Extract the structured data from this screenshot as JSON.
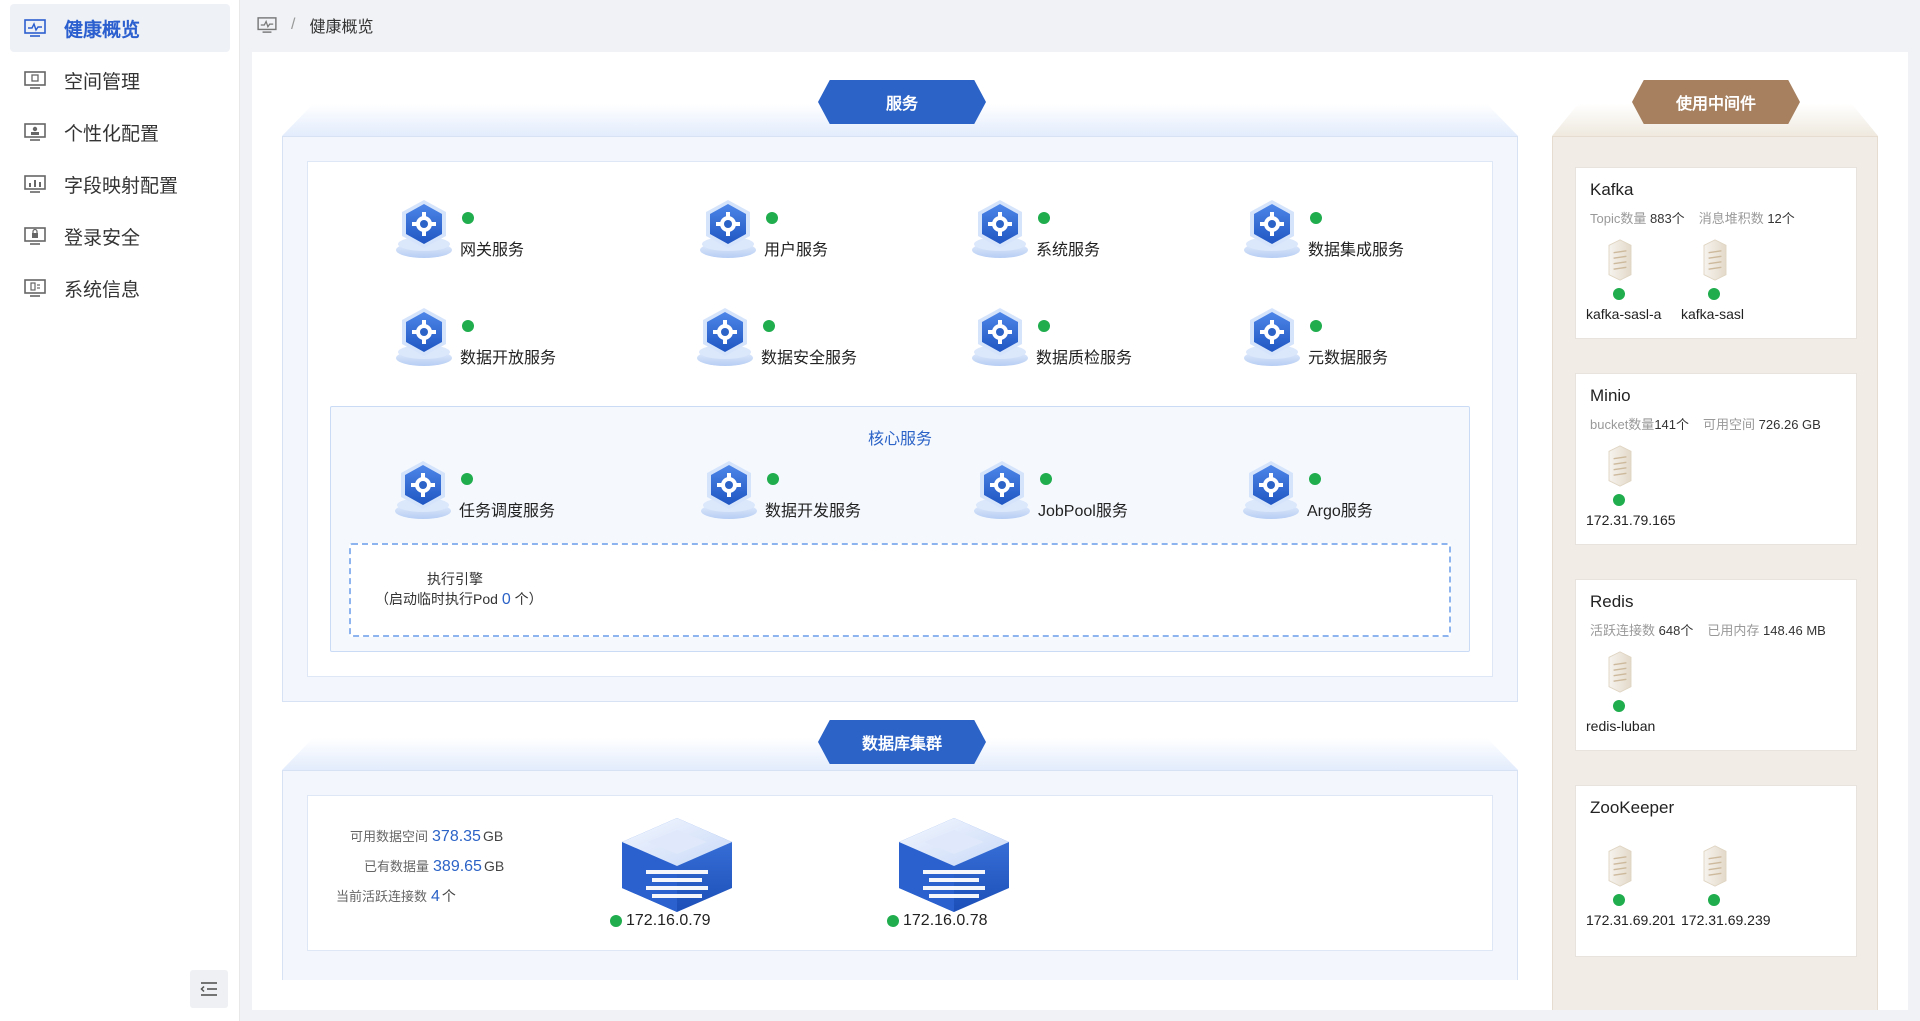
{
  "sidebar": {
    "items": [
      {
        "label": "健康概览",
        "icon": "monitor-pulse-icon",
        "active": true
      },
      {
        "label": "空间管理",
        "icon": "monitor-box-icon",
        "active": false
      },
      {
        "label": "个性化配置",
        "icon": "monitor-user-icon",
        "active": false
      },
      {
        "label": "字段映射配置",
        "icon": "monitor-chart-icon",
        "active": false
      },
      {
        "label": "登录安全",
        "icon": "monitor-lock-icon",
        "active": false
      },
      {
        "label": "系统信息",
        "icon": "monitor-info-icon",
        "active": false
      }
    ],
    "collapse_icon": "collapse-menu-icon"
  },
  "breadcrumb": {
    "separator": "/",
    "current": "健康概览",
    "icon": "monitor-pulse-icon"
  },
  "services": {
    "tag": "服务",
    "items": [
      {
        "name": "网关服务",
        "status": "healthy"
      },
      {
        "name": "用户服务",
        "status": "healthy"
      },
      {
        "name": "系统服务",
        "status": "healthy"
      },
      {
        "name": "数据集成服务",
        "status": "healthy"
      },
      {
        "name": "数据开放服务",
        "status": "healthy"
      },
      {
        "name": "数据安全服务",
        "status": "healthy"
      },
      {
        "name": "数据质检服务",
        "status": "healthy"
      },
      {
        "name": "元数据服务",
        "status": "healthy"
      }
    ],
    "core": {
      "title": "核心服务",
      "items": [
        {
          "name": "任务调度服务",
          "status": "healthy"
        },
        {
          "name": "数据开发服务",
          "status": "healthy"
        },
        {
          "name": "JobPool服务",
          "status": "healthy"
        },
        {
          "name": "Argo服务",
          "status": "healthy"
        }
      ],
      "engine": {
        "title": "执行引擎",
        "prefix": "（启动临时执行Pod",
        "count": "0",
        "suffix": "个）"
      }
    }
  },
  "database": {
    "tag": "数据库集群",
    "stats": [
      {
        "label": "可用数据空间",
        "value": "378.35",
        "unit": "GB"
      },
      {
        "label": "已有数据量",
        "value": "389.65",
        "unit": "GB"
      },
      {
        "label": "当前活跃连接数",
        "value": "4",
        "unit": "个"
      }
    ],
    "nodes": [
      {
        "ip": "172.16.0.79",
        "status": "healthy"
      },
      {
        "ip": "172.16.0.78",
        "status": "healthy"
      }
    ]
  },
  "middleware": {
    "tag": "使用中间件",
    "kafka": {
      "title": "Kafka",
      "meta1_key": "Topic数量",
      "meta1_val": "883个",
      "meta2_key": "消息堆积数",
      "meta2_val": "12个",
      "nodes": [
        "kafka-sasl-a",
        "kafka-sasl"
      ]
    },
    "minio": {
      "title": "Minio",
      "meta1_key": "bucket数量",
      "meta1_val": "141个",
      "meta2_key": "可用空间",
      "meta2_val": "726.26 GB",
      "nodes": [
        "172.31.79.165"
      ]
    },
    "redis": {
      "title": "Redis",
      "meta1_key": "活跃连接数",
      "meta1_val": "648个",
      "meta2_key": "已用内存",
      "meta2_val": "148.46 MB",
      "nodes": [
        "redis-luban"
      ]
    },
    "zookeeper": {
      "title": "ZooKeeper",
      "nodes": [
        "172.31.69.201",
        "172.31.69.239"
      ]
    }
  },
  "colors": {
    "accent": "#2c63c7",
    "healthy": "#1fad4e",
    "middleware": "#a6805f"
  }
}
